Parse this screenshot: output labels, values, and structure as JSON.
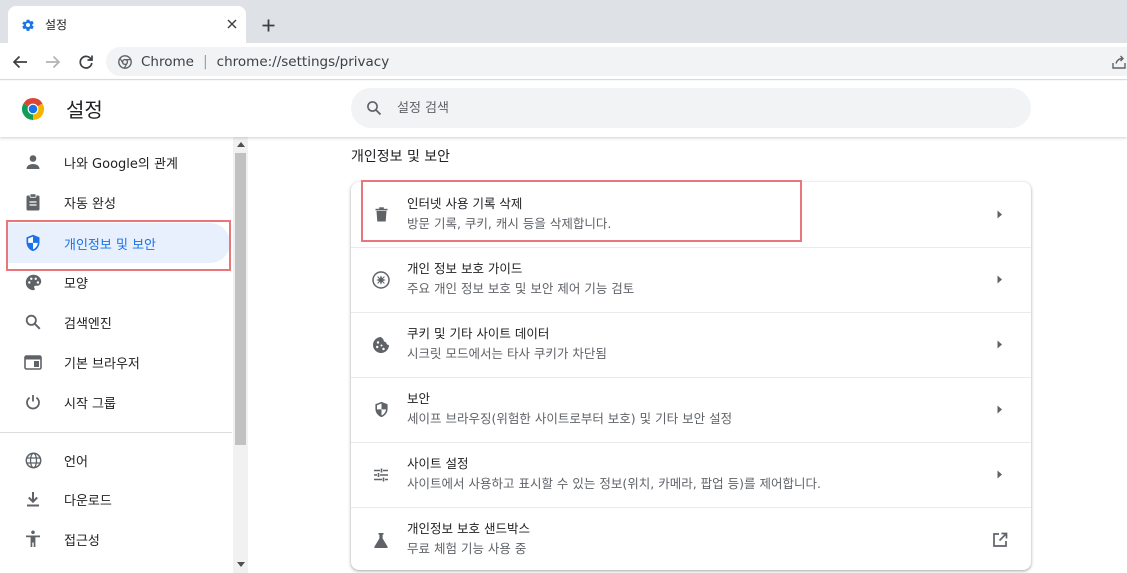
{
  "browser": {
    "tab_title": "설정",
    "omnibox_label": "Chrome",
    "omnibox_separator": "|",
    "url": "chrome://settings/privacy"
  },
  "header": {
    "title": "설정",
    "search_placeholder": "설정 검색"
  },
  "sidebar": {
    "items": [
      {
        "label": "나와 Google의 관계",
        "icon": "person-icon"
      },
      {
        "label": "자동 완성",
        "icon": "clipboard-icon"
      },
      {
        "label": "개인정보 및 보안",
        "icon": "shield-icon",
        "active": true
      },
      {
        "label": "모양",
        "icon": "palette-icon"
      },
      {
        "label": "검색엔진",
        "icon": "search-icon"
      },
      {
        "label": "기본 브라우저",
        "icon": "browser-window-icon"
      },
      {
        "label": "시작 그룹",
        "icon": "power-icon"
      },
      {
        "label": "언어",
        "icon": "globe-icon"
      },
      {
        "label": "다운로드",
        "icon": "download-icon"
      },
      {
        "label": "접근성",
        "icon": "accessibility-icon"
      }
    ]
  },
  "main": {
    "section_title": "개인정보 및 보안",
    "rows": [
      {
        "title": "인터넷 사용 기록 삭제",
        "subtitle": "방문 기록, 쿠키, 캐시 등을 삭제합니다.",
        "icon": "trash-icon"
      },
      {
        "title": "개인 정보 보호 가이드",
        "subtitle": "주요 개인 정보 보호 및 보안 제어 기능 검토",
        "icon": "compass-icon"
      },
      {
        "title": "쿠키 및 기타 사이트 데이터",
        "subtitle": "시크릿 모드에서는 타사 쿠키가 차단됨",
        "icon": "cookie-icon"
      },
      {
        "title": "보안",
        "subtitle": "세이프 브라우징(위험한 사이트로부터 보호) 및 기타 보안 설정",
        "icon": "shield-icon"
      },
      {
        "title": "사이트 설정",
        "subtitle": "사이트에서 사용하고 표시할 수 있는 정보(위치, 카메라, 팝업 등)를 제어합니다.",
        "icon": "sliders-icon"
      },
      {
        "title": "개인정보 보호 샌드박스",
        "subtitle": "무료 체험 기능 사용 중",
        "icon": "flask-icon"
      }
    ]
  },
  "colors": {
    "accent": "#1a73e8",
    "active_bg": "#e8f0fe",
    "highlight": "#e8767b"
  }
}
